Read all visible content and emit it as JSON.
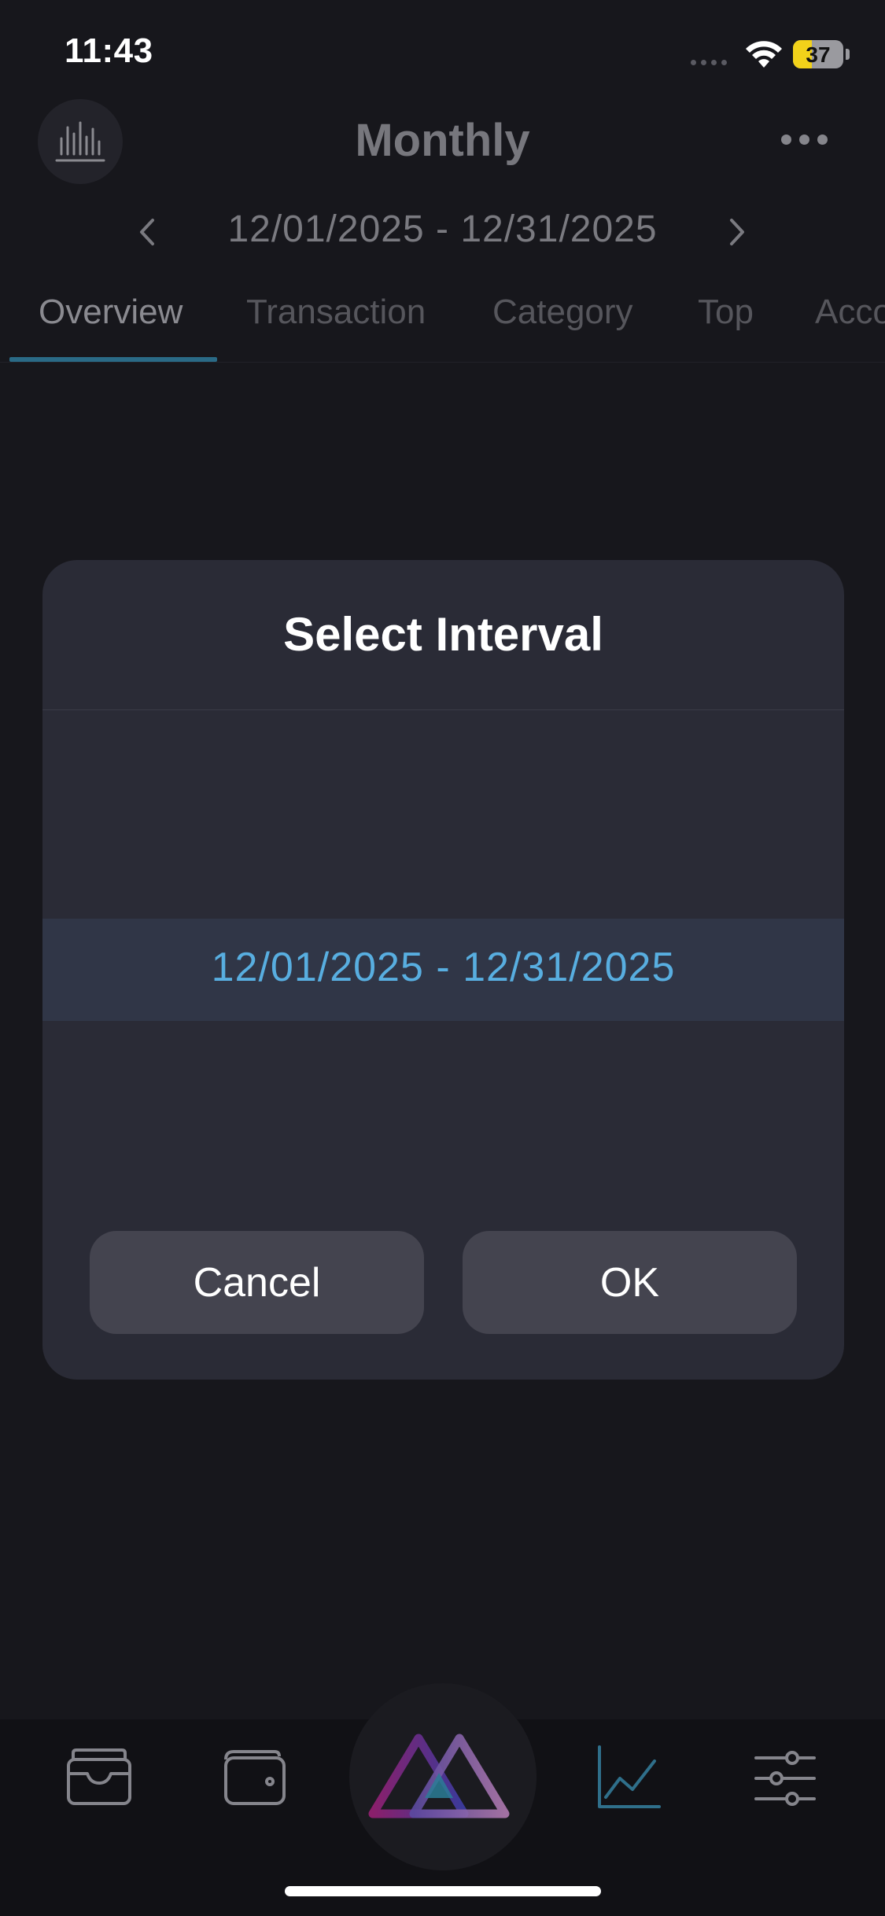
{
  "status_bar": {
    "time": "11:43",
    "battery": "37",
    "battery_level": 0.37
  },
  "header": {
    "title": "Monthly",
    "period": "12/01/2025  -  12/31/2025"
  },
  "tabs": [
    {
      "label": "Overview",
      "active": true
    },
    {
      "label": "Transaction",
      "active": false
    },
    {
      "label": "Category",
      "active": false
    },
    {
      "label": "Top",
      "active": false
    },
    {
      "label": "Acco",
      "active": false
    }
  ],
  "dialog": {
    "title": "Select Interval",
    "selected_interval": "12/01/2025  -  12/31/2025",
    "cancel_label": "Cancel",
    "ok_label": "OK"
  },
  "bottom_nav": {
    "items": [
      {
        "icon": "wallet-card-icon"
      },
      {
        "icon": "wallet-icon"
      },
      {
        "icon": "app-logo-icon"
      },
      {
        "icon": "chart-line-icon",
        "active": true
      },
      {
        "icon": "sliders-icon"
      }
    ]
  },
  "colors": {
    "accent": "#58aee0",
    "tab_indicator": "#2a6a86",
    "battery": "#f2d21a",
    "background": "#17171c",
    "dialog": "#2a2b36"
  }
}
